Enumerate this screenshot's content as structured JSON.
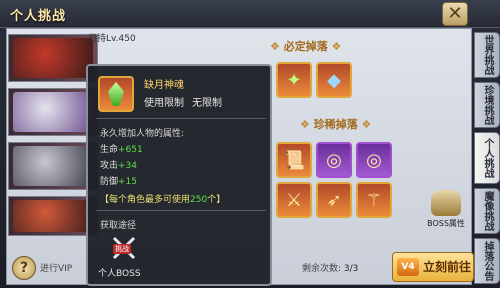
{
  "window": {
    "title": "个人挑战",
    "close_label": "✕"
  },
  "boss": {
    "level_tag": "日持Lv.450"
  },
  "drops": {
    "guaranteed_title": "必定掉落",
    "rare_title": "珍稀掉落",
    "boss_attr_label": "BOSS属性"
  },
  "side_tabs": [
    {
      "label": "世界挑战"
    },
    {
      "label": "珍境挑战"
    },
    {
      "label": "个人挑战"
    },
    {
      "label": "魔像挑战"
    },
    {
      "label": "掉落公告"
    }
  ],
  "bottom": {
    "help_label": "?",
    "hint_text": "进行VIP",
    "remaining_label": "剩余次数:",
    "remaining_value": "3/3",
    "go_badge": "V4",
    "go_label": "立刻前往"
  },
  "popup": {
    "item_name": "缺月神魂",
    "limit_label": "使用限制",
    "limit_value": "无限制",
    "desc": "永久增加人物的属性:",
    "stats": [
      {
        "name": "生命",
        "value": "+651"
      },
      {
        "name": "攻击",
        "value": "+34"
      },
      {
        "name": "防御",
        "value": "+15"
      }
    ],
    "note_prefix": "【每个角色最多可使用",
    "note_count": "250",
    "note_suffix": "个】",
    "source_title": "获取途径",
    "source_tag": "挑战",
    "source_label": "个人BOSS"
  },
  "colors": {
    "accent_gold": "#e0a83a",
    "stat_green": "#5ee04a",
    "title_text": "#ffe9a8"
  }
}
